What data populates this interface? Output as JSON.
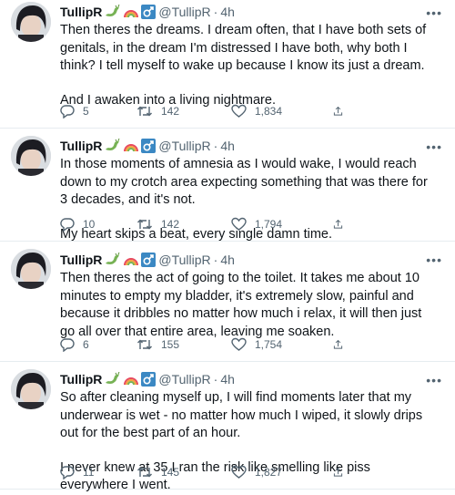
{
  "tweets": [
    {
      "name": "TullipR",
      "handle": "@TullipR",
      "separator": "·",
      "time": "4h",
      "paragraphs": [
        "Then theres the dreams. I dream often, that I have both sets of genitals, in the dream I'm distressed I have both, why both I think? I tell myself to wake up because I know its just a dream.",
        "And I awaken into a living nightmare."
      ],
      "replies": "5",
      "retweets": "142",
      "likes": "1,834"
    },
    {
      "name": "TullipR",
      "handle": "@TullipR",
      "separator": "·",
      "time": "4h",
      "paragraphs": [
        "In those moments of amnesia as I would wake, I would reach down to my crotch area expecting something that was there for 3 decades, and it's not.",
        "My heart skips a beat, every single damn time."
      ],
      "replies": "10",
      "retweets": "142",
      "likes": "1,794"
    },
    {
      "name": "TullipR",
      "handle": "@TullipR",
      "separator": "·",
      "time": "4h",
      "paragraphs": [
        "Then theres the act of going to the toilet. It takes me about 10 minutes to empty my bladder, it's extremely slow, painful and because it dribbles no matter how much i relax, it will then just go all over that entire area, leaving me soaken."
      ],
      "replies": "6",
      "retweets": "155",
      "likes": "1,754"
    },
    {
      "name": "TullipR",
      "handle": "@TullipR",
      "separator": "·",
      "time": "4h",
      "paragraphs": [
        "So after cleaning myself up, I will find moments later that my underwear is wet - no matter how much I wiped, it slowly drips out for the best part of an hour.",
        "I never knew at 35 I ran the risk like smelling like piss everywhere I went."
      ],
      "replies": "11",
      "retweets": "145",
      "likes": "1,827"
    }
  ],
  "icons": {
    "emoji_1": "dragon-emoji",
    "emoji_2": "rainbow-emoji",
    "emoji_3": "male-sign-emoji",
    "more": "more-icon",
    "reply": "reply-icon",
    "retweet": "retweet-icon",
    "like": "heart-icon",
    "share": "share-icon"
  },
  "colors": {
    "text": "#0f1419",
    "secondary": "#536471",
    "divider": "#e6ecf0",
    "male_sign_bg": "#3b88c3"
  }
}
